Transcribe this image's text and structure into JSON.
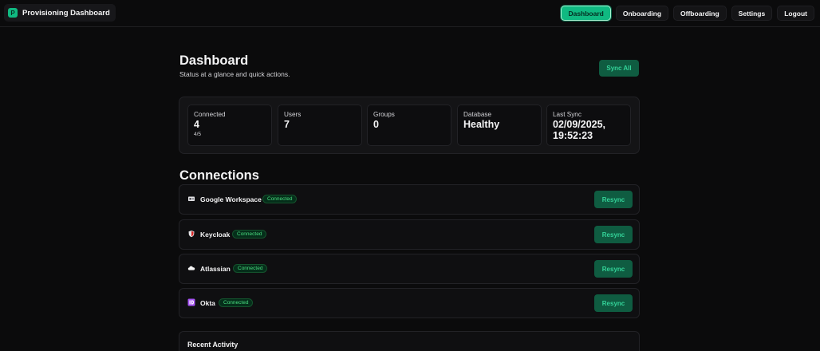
{
  "app": {
    "logo_letter": "P",
    "title": "Provisioning Dashboard"
  },
  "nav": {
    "dashboard": "Dashboard",
    "onboarding": "Onboarding",
    "offboarding": "Offboarding",
    "settings": "Settings",
    "logout": "Logout"
  },
  "header": {
    "title": "Dashboard",
    "subtitle": "Status at a glance and quick actions.",
    "sync_all_label": "Sync All"
  },
  "stats": [
    {
      "label": "Connected",
      "value": "4",
      "sub": "4/5"
    },
    {
      "label": "Users",
      "value": "7",
      "sub": ""
    },
    {
      "label": "Groups",
      "value": "0",
      "sub": ""
    },
    {
      "label": "Database",
      "value": "Healthy",
      "sub": ""
    },
    {
      "label": "Last Sync",
      "value": "02/09/2025,\n19:52:23",
      "sub": ""
    }
  ],
  "connections": {
    "title": "Connections",
    "items": [
      {
        "icon": "google-workspace-icon",
        "name": "Google Workspace",
        "status": "Connected",
        "action": "Resync"
      },
      {
        "icon": "keycloak-shield-icon",
        "name": "Keycloak",
        "status": "Connected",
        "action": "Resync"
      },
      {
        "icon": "atlassian-cloud-icon",
        "name": "Atlassian",
        "status": "Connected",
        "action": "Resync"
      },
      {
        "icon": "okta-id-icon",
        "name": "Okta",
        "status": "Connected",
        "action": "Resync"
      }
    ]
  },
  "activity": {
    "title": "Recent Activity"
  },
  "colors": {
    "accent": "#10b981",
    "accent_dark": "#0f5c41",
    "background": "#0b0b0c",
    "status_connected": "#4ade80"
  }
}
